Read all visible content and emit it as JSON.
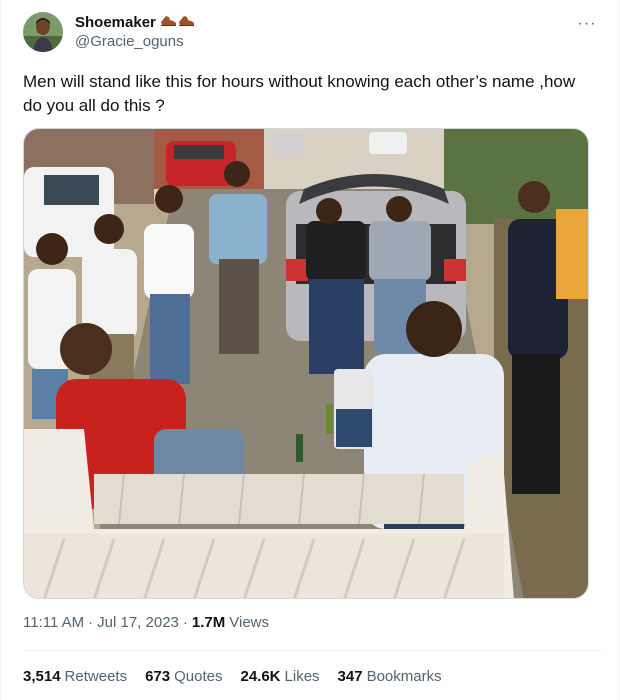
{
  "author": {
    "display_name": "Shoemaker",
    "handle": "@Gracie_oguns",
    "name_icons": "two shoe emoji"
  },
  "more_label": "···",
  "tweet": {
    "text": "Men will stand like this for hours without knowing each other’s name ,how do you all do this ?"
  },
  "meta": {
    "time": "11:11 AM",
    "sep1": "·",
    "date": "Jul 17, 2023",
    "sep2": "·",
    "views_count": "1.7M",
    "views_label": "Views"
  },
  "stats": [
    {
      "count": "3,514",
      "label": "Retweets"
    },
    {
      "count": "673",
      "label": "Quotes"
    },
    {
      "count": "24.6K",
      "label": "Likes"
    },
    {
      "count": "347",
      "label": "Bookmarks"
    }
  ],
  "colors": {
    "text_primary": "#0f1419",
    "text_secondary": "#536471",
    "border": "#eff3f4"
  }
}
